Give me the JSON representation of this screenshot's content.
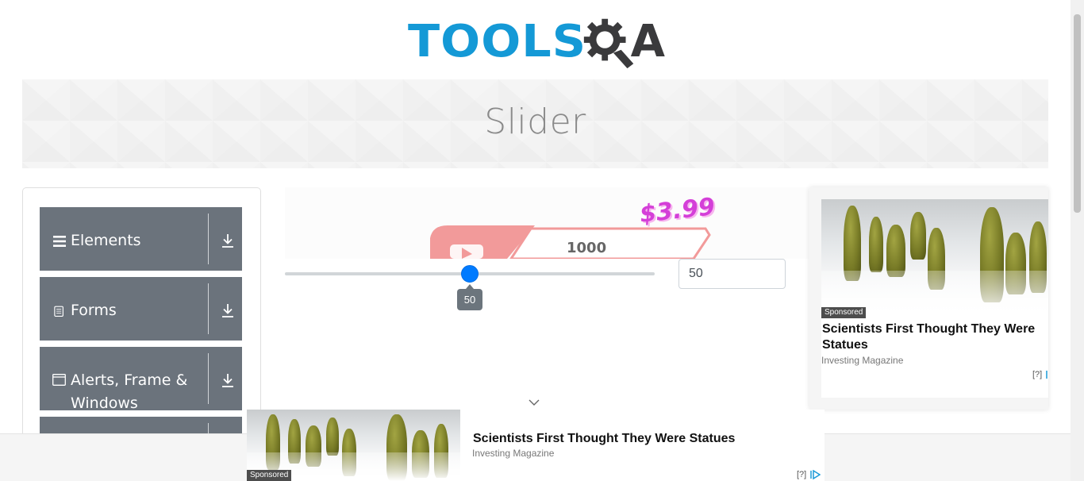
{
  "logo": {
    "part1": "TOOLS",
    "part2": "A",
    "colors": {
      "tools": "#1499d6",
      "qa": "#3a3a3c"
    }
  },
  "banner": {
    "title": "Slider"
  },
  "sidebar": {
    "groups": [
      {
        "label": "Elements",
        "icon": "menu-icon"
      },
      {
        "label": "Forms",
        "icon": "document-icon"
      },
      {
        "label": "Alerts, Frame & Windows",
        "label_line1": "Alerts, Frame &",
        "label_line2": "Windows",
        "icon": "window-icon"
      }
    ]
  },
  "promo": {
    "price": "$3.99"
  },
  "slider": {
    "value": "50",
    "tooltip": "50",
    "min": 0,
    "max": 100,
    "accent": "#007bff"
  },
  "right_ad": {
    "sponsored": "Sponsored",
    "title": "Scientists First Thought They Were Statues",
    "source": "Investing Magazine",
    "choice": "[?]"
  },
  "bottom_ad": {
    "sponsored": "Sponsored",
    "title": "Scientists First Thought They Were Statues",
    "source": "Investing Magazine",
    "choice": "[?]"
  }
}
